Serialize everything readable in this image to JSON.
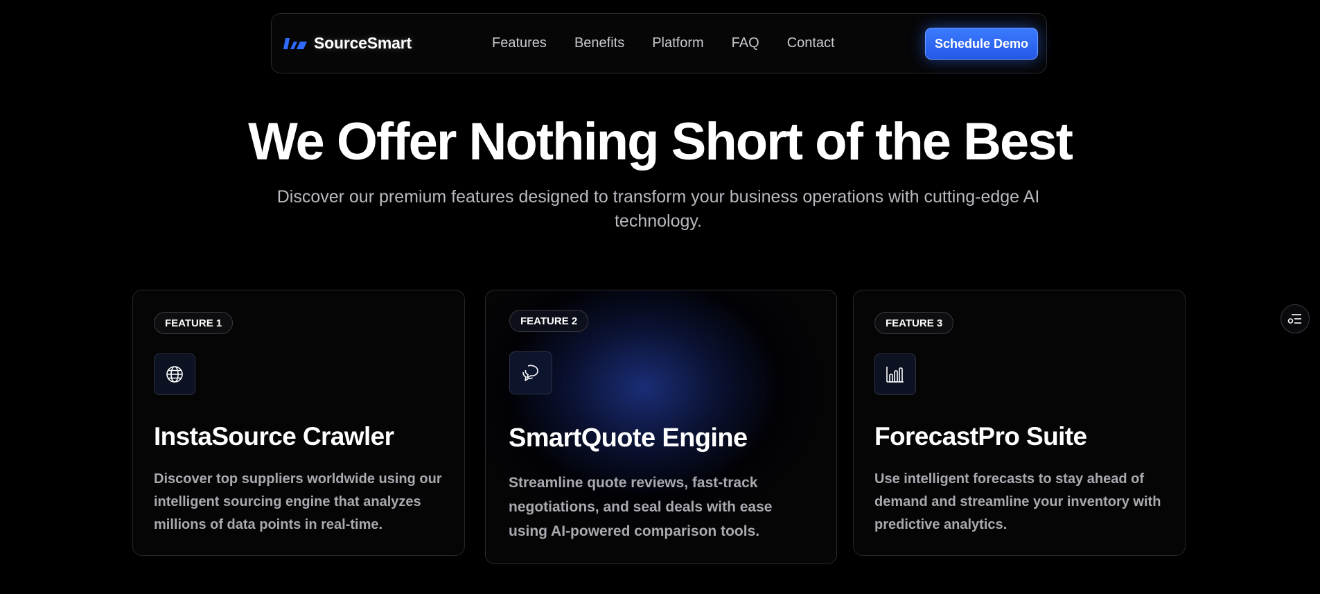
{
  "brand": {
    "name": "SourceSmart",
    "logo_color": "#2f6bff"
  },
  "nav": {
    "links": [
      "Features",
      "Benefits",
      "Platform",
      "FAQ",
      "Contact"
    ],
    "cta_label": "Schedule Demo"
  },
  "hero": {
    "title": "We Offer Nothing Short of the Best",
    "subtitle": "Discover our premium features designed to transform your business operations with cutting-edge AI technology."
  },
  "features": [
    {
      "badge": "FEATURE 1",
      "icon": "globe-icon",
      "title": "InstaSource Crawler",
      "description": "Discover top suppliers worldwide using our intelligent sourcing engine that analyzes millions of data points in real-time."
    },
    {
      "badge": "FEATURE 2",
      "icon": "chat-bubbles-icon",
      "title": "SmartQuote Engine",
      "description": "Streamline quote reviews, fast-track negotiations, and seal deals with ease using AI-powered comparison tools."
    },
    {
      "badge": "FEATURE 3",
      "icon": "bar-chart-icon",
      "title": "ForecastPro Suite",
      "description": "Use intelligent forecasts to stay ahead of demand and streamline your inventory with predictive analytics."
    }
  ],
  "side_widget": {
    "icon": "settings-toggle-icon"
  },
  "colors": {
    "background": "#000000",
    "accent": "#2f6bff",
    "glow": "#1c307d"
  }
}
